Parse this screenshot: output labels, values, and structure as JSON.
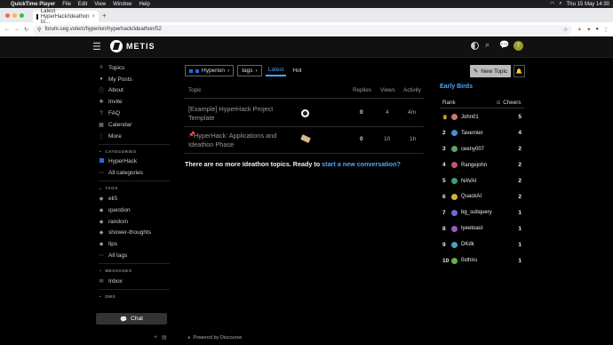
{
  "mac": {
    "app": "QuickTime Player",
    "menus": [
      "File",
      "Edit",
      "View",
      "Window",
      "Help"
    ],
    "clock": "Thu 15 May 14:30"
  },
  "browser": {
    "tab_title": "Latest HyperHack/Ideathon to…",
    "url": "forum.ceg.vote/c/hyperion/hyperhack/ideathon/52"
  },
  "header": {
    "logo": "METIS",
    "avatar": "T"
  },
  "sidebar": {
    "items": [
      {
        "label": "Topics",
        "icon": "topics-icon"
      },
      {
        "label": "My Posts",
        "icon": "user-icon"
      },
      {
        "label": "About",
        "icon": "info-icon"
      },
      {
        "label": "Invite",
        "icon": "invite-icon"
      },
      {
        "label": "FAQ",
        "icon": "faq-icon"
      },
      {
        "label": "Calendar",
        "icon": "calendar-icon"
      },
      {
        "label": "More",
        "icon": "more-icon"
      }
    ],
    "categories_heading": "CATEGORIES",
    "categories": [
      "HyperHack",
      "All categories"
    ],
    "tags_heading": "TAGS",
    "tags": [
      "eli5",
      "question",
      "random",
      "shower-thoughts",
      "tips",
      "All tags"
    ],
    "messages_heading": "MESSAGES",
    "messages": [
      "Inbox"
    ],
    "dms_heading": "DMS",
    "chat": "Chat"
  },
  "nav": {
    "breadcrumb_category": "Hyperion",
    "breadcrumb_tags": "tags",
    "tab_latest": "Latest",
    "tab_hot": "Hot",
    "new_topic": "New Topic"
  },
  "table": {
    "headers": {
      "topic": "Topic",
      "replies": "Replies",
      "views": "Views",
      "activity": "Activity"
    },
    "rows": [
      {
        "title": "[Example] HyperHack Project Template",
        "replies": "0",
        "views": "4",
        "activity": "4m"
      },
      {
        "title": "HyperHack: Applications and Ideathon Phase",
        "replies": "0",
        "views": "10",
        "activity": "1h"
      }
    ]
  },
  "footer_msg": {
    "text": "There are no more Ideathon topics. Ready to ",
    "link": "start a new conversation?"
  },
  "powered": "Powered by Discourse",
  "leaderboard": {
    "title": "Early Birds",
    "rank_header": "Rank",
    "cheers_header": "Cheers",
    "rows": [
      {
        "rank": "",
        "name": "John01",
        "cheers": "5",
        "color": "#c97a6b"
      },
      {
        "rank": "2",
        "name": "Tavernier",
        "cheers": "4",
        "color": "#4a8fd0"
      },
      {
        "rank": "3",
        "name": "ceeny007",
        "cheers": "2",
        "color": "#5aa46a"
      },
      {
        "rank": "4",
        "name": "Rangejohn",
        "cheers": "2",
        "color": "#c0566a"
      },
      {
        "rank": "5",
        "name": "NAVAI",
        "cheers": "2",
        "color": "#3d9b7a"
      },
      {
        "rank": "6",
        "name": "QuackAI",
        "cheers": "2",
        "color": "#d9b23a"
      },
      {
        "rank": "7",
        "name": "bg_subquery",
        "cheers": "1",
        "color": "#6b6bd0"
      },
      {
        "rank": "8",
        "name": "tyeetoast",
        "cheers": "1",
        "color": "#9b5ac0"
      },
      {
        "rank": "9",
        "name": "DKdk",
        "cheers": "1",
        "color": "#4aa0c0"
      },
      {
        "rank": "10",
        "name": "0xthiru",
        "cheers": "1",
        "color": "#6ab04a"
      }
    ]
  }
}
